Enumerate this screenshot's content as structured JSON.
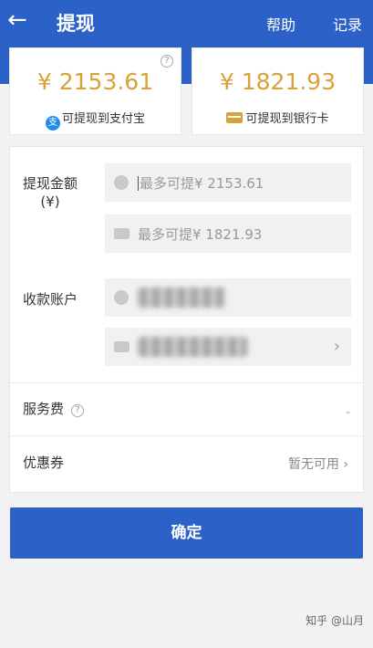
{
  "header": {
    "back_glyph": "←",
    "title": "提现",
    "help": "帮助",
    "records": "记录"
  },
  "balances": {
    "alipay": {
      "amount": "¥ 2153.61",
      "label": "可提现到支付宝",
      "icon": "alipay-icon"
    },
    "bank": {
      "amount": "¥ 1821.93",
      "label": "可提现到银行卡",
      "icon": "bank-card-icon"
    }
  },
  "form": {
    "amount_label_line1": "提现金额",
    "amount_label_line2": "(¥)",
    "alipay_placeholder": "最多可提¥ 2153.61",
    "bank_placeholder": "最多可提¥ 1821.93",
    "account_label": "收款账户",
    "fee_label": "服务费",
    "fee_value": "-",
    "coupon_label": "优惠券",
    "coupon_value": "暂无可用"
  },
  "confirm_label": "确定",
  "watermark": "知乎 @山月",
  "colors": {
    "primary": "#2c62c8",
    "amount_gold": "#d7a13b",
    "alipay_blue": "#1e8df0"
  }
}
